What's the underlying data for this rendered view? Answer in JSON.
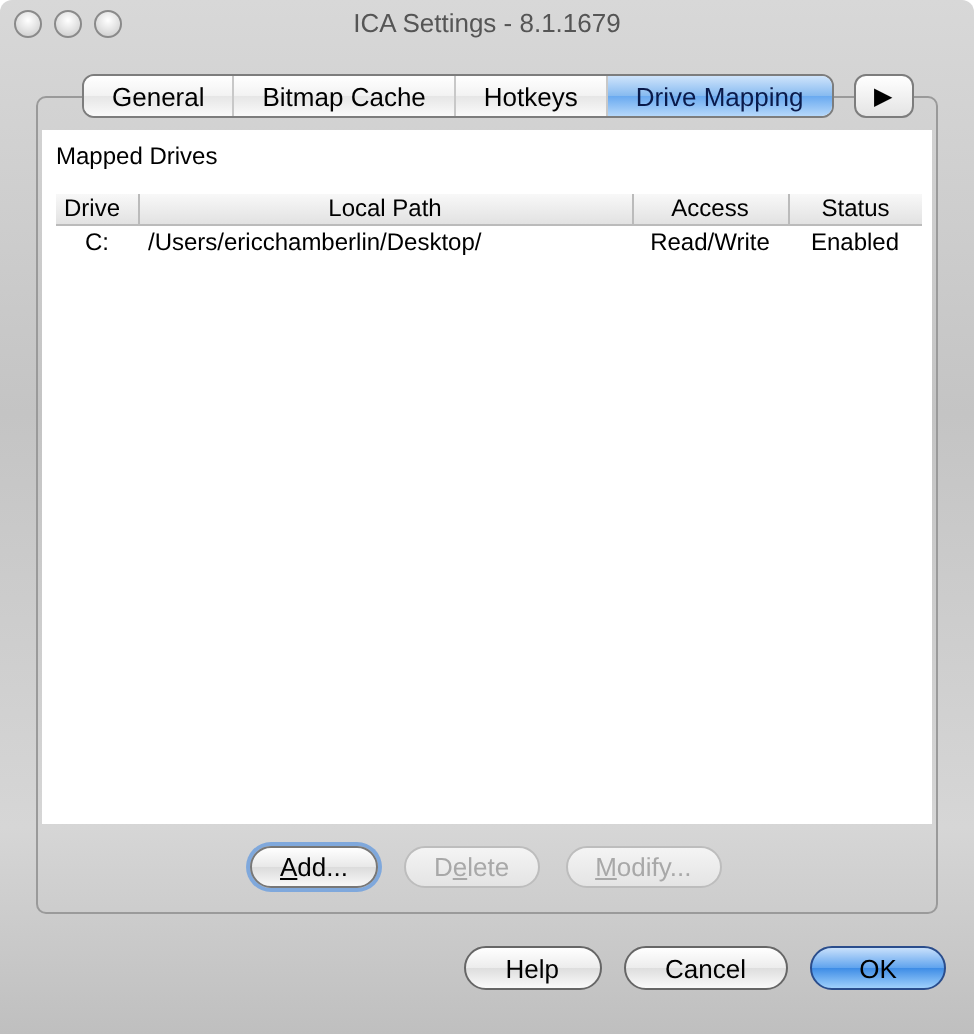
{
  "window": {
    "title": "ICA Settings - 8.1.1679"
  },
  "tabs": [
    {
      "label": "General",
      "selected": false
    },
    {
      "label": "Bitmap Cache",
      "selected": false
    },
    {
      "label": "Hotkeys",
      "selected": false
    },
    {
      "label": "Drive Mapping",
      "selected": true
    }
  ],
  "tab_scroll": {
    "label": "▶"
  },
  "panel": {
    "title": "Mapped Drives",
    "table": {
      "columns": [
        "Drive",
        "Local Path",
        "Access",
        "Status"
      ],
      "rows": [
        [
          "C:",
          "/Users/ericchamberlin/Desktop/",
          "Read/Write",
          "Enabled"
        ]
      ]
    },
    "buttons": [
      {
        "mnemonic": "A",
        "after": "dd...",
        "disabled": false,
        "focused": true
      },
      {
        "before": "D",
        "mnemonic": "e",
        "after": "lete",
        "disabled": true,
        "focused": false
      },
      {
        "mnemonic": "M",
        "after": "odify...",
        "disabled": true,
        "focused": false
      }
    ]
  },
  "dialog_buttons": [
    {
      "label": "Help",
      "default": false
    },
    {
      "label": "Cancel",
      "default": false
    },
    {
      "label": "OK",
      "default": true
    }
  ]
}
